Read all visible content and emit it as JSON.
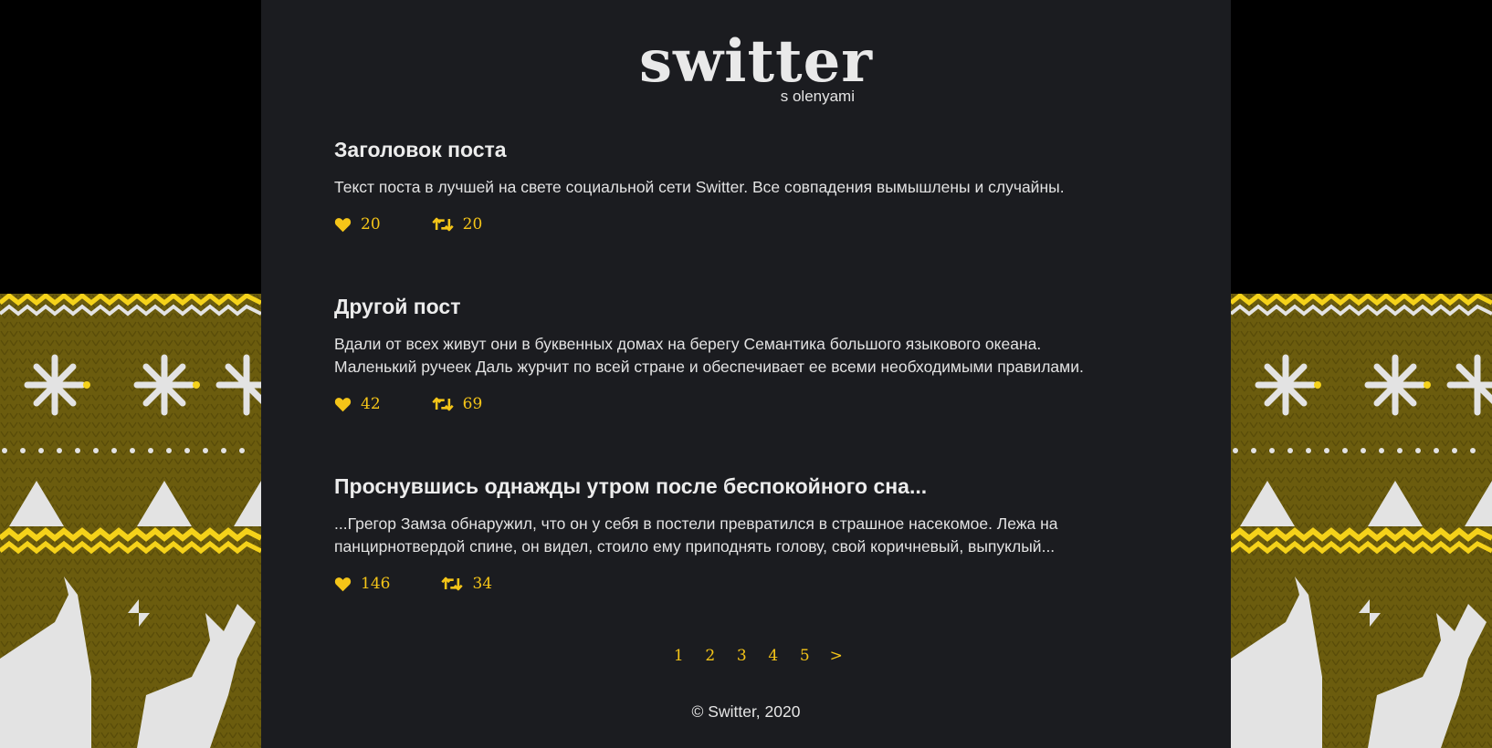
{
  "header": {
    "title": "switter",
    "subtitle": "s olenyami"
  },
  "posts": [
    {
      "title": "Заголовок поста",
      "lines": [
        "Текст поста в лучшей на свете социальной сети Switter. Все совпадения вымышлены и случайны."
      ],
      "likes": "20",
      "reposts": "20"
    },
    {
      "title": "Другой пост",
      "lines": [
        "Вдали от всех живут они в буквенных домах на берегу Семантика большого языкового океана.",
        "Маленький ручеек Даль журчит по всей стране и обеспечивает ее всеми необходимыми правилами."
      ],
      "likes": "42",
      "reposts": "69"
    },
    {
      "title": "Проснувшись однажды утром после беспокойного сна...",
      "lines": [
        "...Грегор Замза обнаружил, что он у себя в постели превратился в страшное насекомое. Лежа на",
        "панцирнотвердой спине, он видел, стоило ему приподнять голову, свой коричневый, выпуклый..."
      ],
      "likes": "146",
      "reposts": "34"
    }
  ],
  "pagination": {
    "pages": [
      "1",
      "2",
      "3",
      "4",
      "5"
    ],
    "next": ">"
  },
  "footer": {
    "copyright": "© Switter, 2020"
  },
  "icons": {
    "like": "heart-icon",
    "repost": "retweet-icon"
  },
  "colors": {
    "accent": "#f5c518",
    "panel": "#1b1c20",
    "page_bg": "#000000",
    "sweater_base": "#6b5c0e",
    "sweater_white": "#e3e3e3",
    "sweater_yellow": "#f5d21a"
  }
}
